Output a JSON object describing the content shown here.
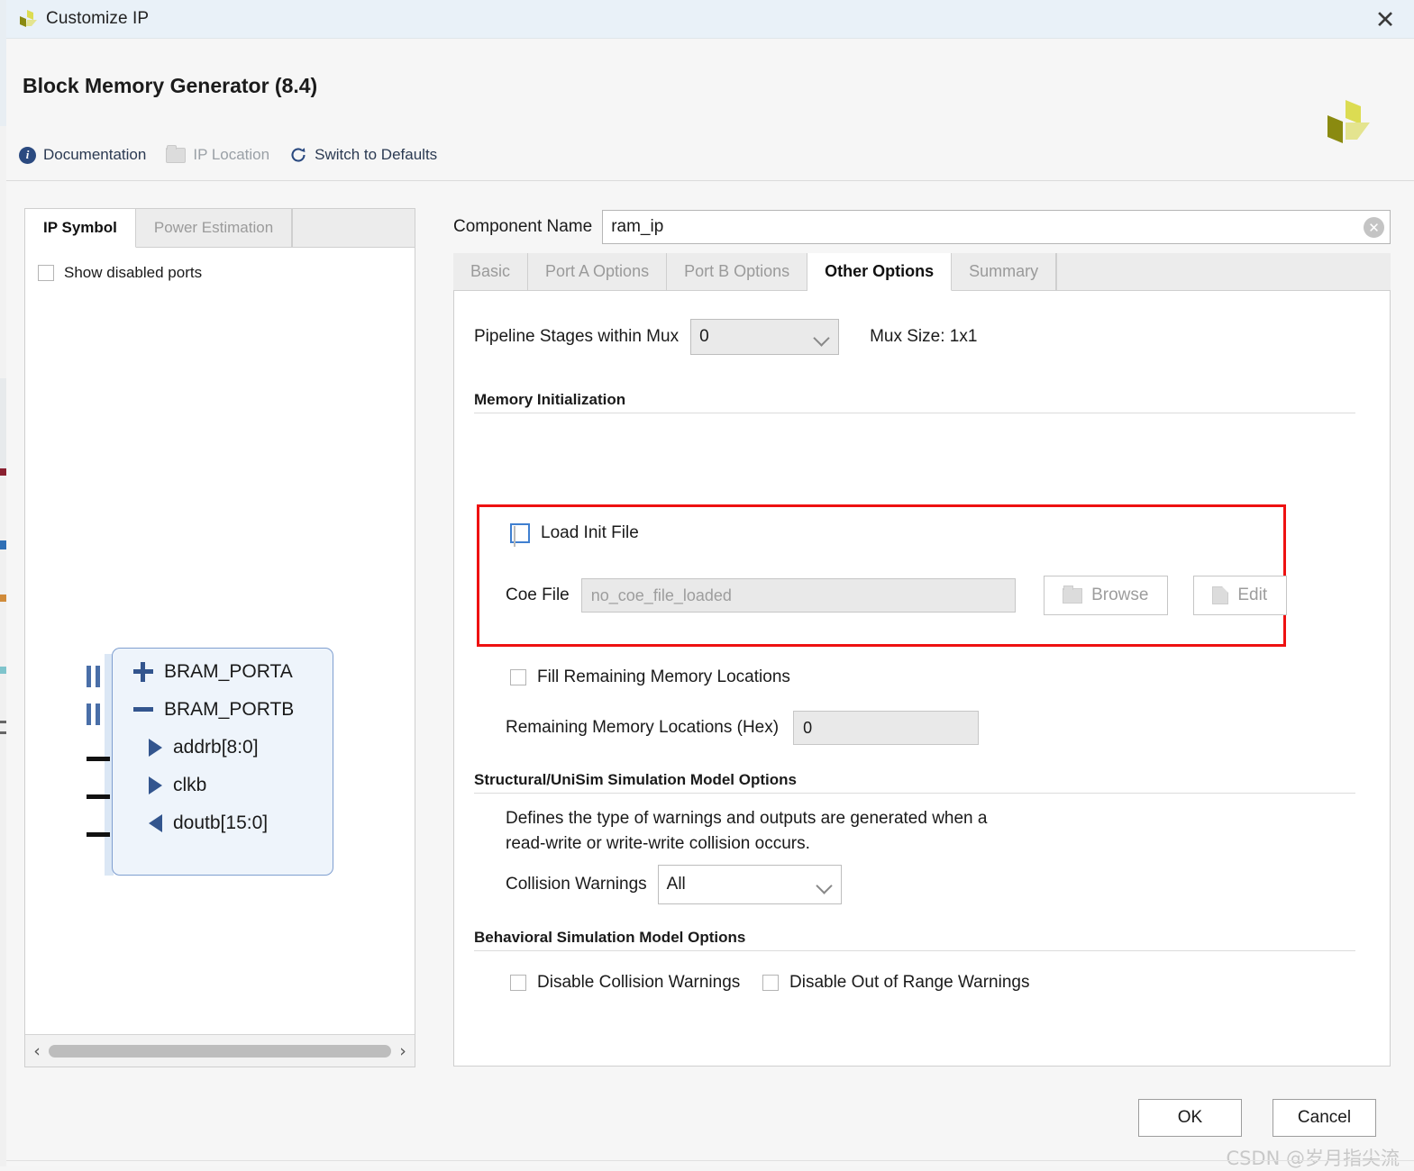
{
  "window": {
    "title": "Customize IP",
    "close_icon": "close-icon",
    "app_icon": "xilinx-logo-icon"
  },
  "header": {
    "title": "Block Memory Generator (8.4)",
    "logo_icon": "xilinx-logo-icon",
    "toolbar": [
      {
        "label": "Documentation",
        "icon": "info-icon",
        "enabled": true
      },
      {
        "label": "IP Location",
        "icon": "folder-icon",
        "enabled": false
      },
      {
        "label": "Switch to Defaults",
        "icon": "refresh-icon",
        "enabled": true
      }
    ]
  },
  "left_panel": {
    "tabs": [
      {
        "label": "IP Symbol",
        "active": true
      },
      {
        "label": "Power Estimation",
        "active": false
      }
    ],
    "show_disabled_ports": {
      "label": "Show disabled ports",
      "checked": false
    },
    "symbol": {
      "ports": [
        {
          "name": "BRAM_PORTA",
          "marker": "plus"
        },
        {
          "name": "BRAM_PORTB",
          "marker": "minus"
        },
        {
          "name": "addrb[8:0]",
          "marker": "input-arrow"
        },
        {
          "name": "clkb",
          "marker": "input-arrow"
        },
        {
          "name": "doutb[15:0]",
          "marker": "output-arrow"
        }
      ]
    },
    "scroll": {
      "left_arrow": "‹",
      "right_arrow": "›"
    }
  },
  "component": {
    "label": "Component Name",
    "value": "ram_ip",
    "clear_icon": "clear-circle-icon"
  },
  "tabs": [
    {
      "label": "Basic",
      "active": false
    },
    {
      "label": "Port A Options",
      "active": false
    },
    {
      "label": "Port B Options",
      "active": false
    },
    {
      "label": "Other Options",
      "active": true
    },
    {
      "label": "Summary",
      "active": false
    }
  ],
  "other_options": {
    "pipeline": {
      "label": "Pipeline Stages within Mux",
      "value": "0",
      "mux_size": "Mux Size: 1x1"
    },
    "memory_initialization": {
      "heading": "Memory Initialization",
      "load_init_file": {
        "label": "Load Init File",
        "checked": false
      },
      "coe_file": {
        "label": "Coe File",
        "placeholder": "no_coe_file_loaded",
        "value": ""
      },
      "browse_button": {
        "label": "Browse",
        "icon": "folder-icon",
        "enabled": false
      },
      "edit_button": {
        "label": "Edit",
        "icon": "page-icon",
        "enabled": false
      },
      "highlight_color": "#ee1111"
    },
    "fill_remaining": {
      "label": "Fill Remaining Memory Locations",
      "checked": false
    },
    "remaining_locations": {
      "label": "Remaining Memory Locations (Hex)",
      "value": "0"
    },
    "structural": {
      "heading": "Structural/UniSim Simulation Model Options",
      "description_line1": "Defines the type of warnings and outputs are generated when a",
      "description_line2": "read-write or write-write collision occurs.",
      "collision_warnings": {
        "label": "Collision Warnings",
        "value": "All"
      }
    },
    "behavioral": {
      "heading": "Behavioral Simulation Model Options",
      "disable_collision": {
        "label": "Disable Collision Warnings",
        "checked": false
      },
      "disable_out_of_range": {
        "label": "Disable Out of Range Warnings",
        "checked": false
      }
    }
  },
  "footer": {
    "ok_label": "OK",
    "cancel_label": "Cancel",
    "watermark": "CSDN @岁月指尖流"
  }
}
